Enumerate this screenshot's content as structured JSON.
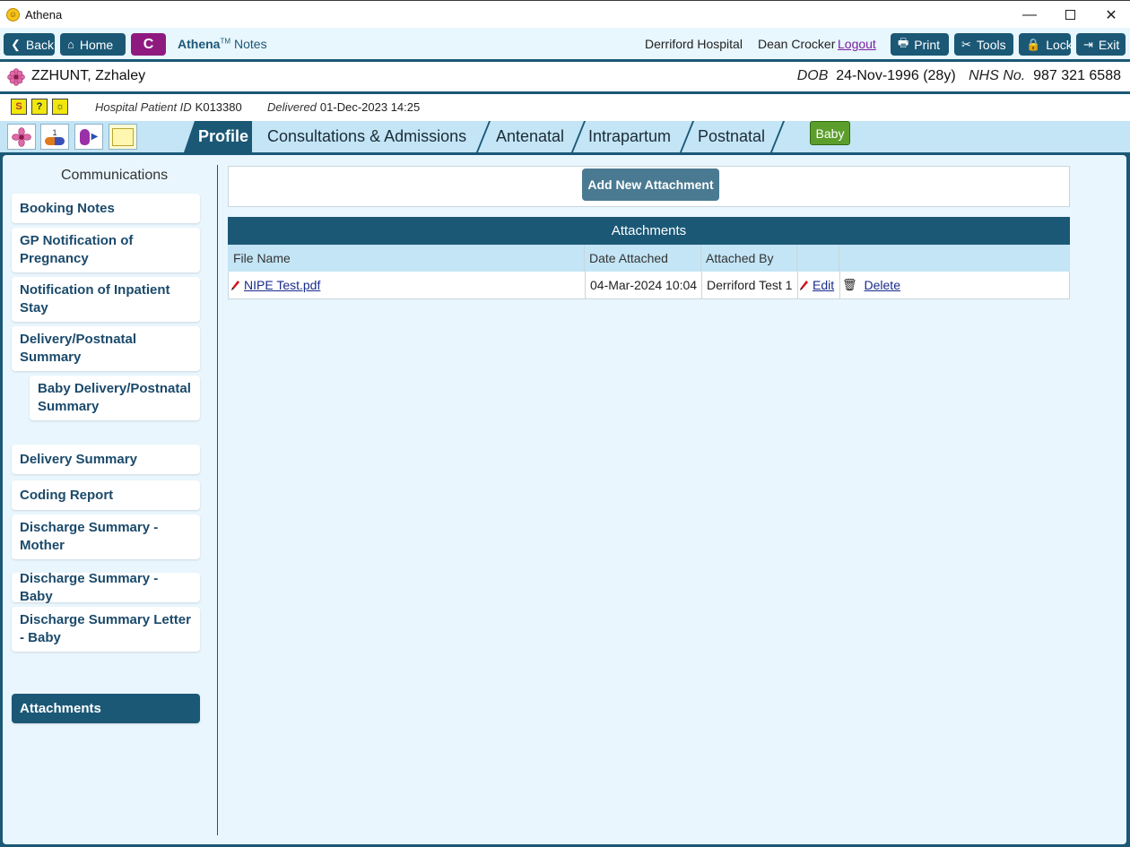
{
  "window": {
    "title": "Athena"
  },
  "toolbar": {
    "back": "Back",
    "home": "Home",
    "c": "C",
    "brand": "Athena",
    "brand_tm": "TM",
    "notes": "Notes",
    "hospital": "Derriford Hospital",
    "user": "Dean Crocker",
    "logout": "Logout",
    "print": "Print",
    "tools": "Tools",
    "lock": "Lock",
    "exit": "Exit"
  },
  "patient": {
    "name": "ZZHUNT, Zzhaley",
    "dob_label": "DOB",
    "dob": "24-Nov-1996 (28y)",
    "nhs_label": "NHS No.",
    "nhs": "987 321 6588"
  },
  "info": {
    "hpid_label": "Hospital Patient ID",
    "hpid": "K013380",
    "delivered_label": "Delivered",
    "delivered": "01-Dec-2023 14:25",
    "icon1": "S",
    "icon2": "?",
    "icon3": "☼"
  },
  "tabs": {
    "profile": "Profile",
    "consultations": "Consultations & Admissions",
    "antenatal": "Antenatal",
    "intrapartum": "Intrapartum",
    "postnatal": "Postnatal",
    "baby": "Baby",
    "counter": "1"
  },
  "sidebar": {
    "heading": "Communications",
    "items": [
      "Booking Notes",
      "GP Notification of Pregnancy",
      "Notification of Inpatient Stay",
      "Delivery/Postnatal Summary",
      "Baby Delivery/Postnatal Summary",
      "Delivery Summary",
      "Coding Report",
      "Discharge Summary - Mother",
      "Discharge Summary - Baby",
      "Discharge Summary Letter - Baby",
      "Attachments"
    ]
  },
  "content": {
    "add_button": "Add New Attachment",
    "table_title": "Attachments",
    "columns": [
      "File Name",
      "Date Attached",
      "Attached By",
      "",
      ""
    ],
    "rows": [
      {
        "file": "NIPE Test.pdf",
        "date": "04-Mar-2024 10:04",
        "by": "Derriford Test 1",
        "edit": "Edit",
        "delete": "Delete"
      }
    ]
  },
  "colors": {
    "primary": "#1b5876",
    "accent_purple": "#8e1a7f",
    "baby_green": "#5c9e2c",
    "light_bg": "#e9f6fd"
  }
}
